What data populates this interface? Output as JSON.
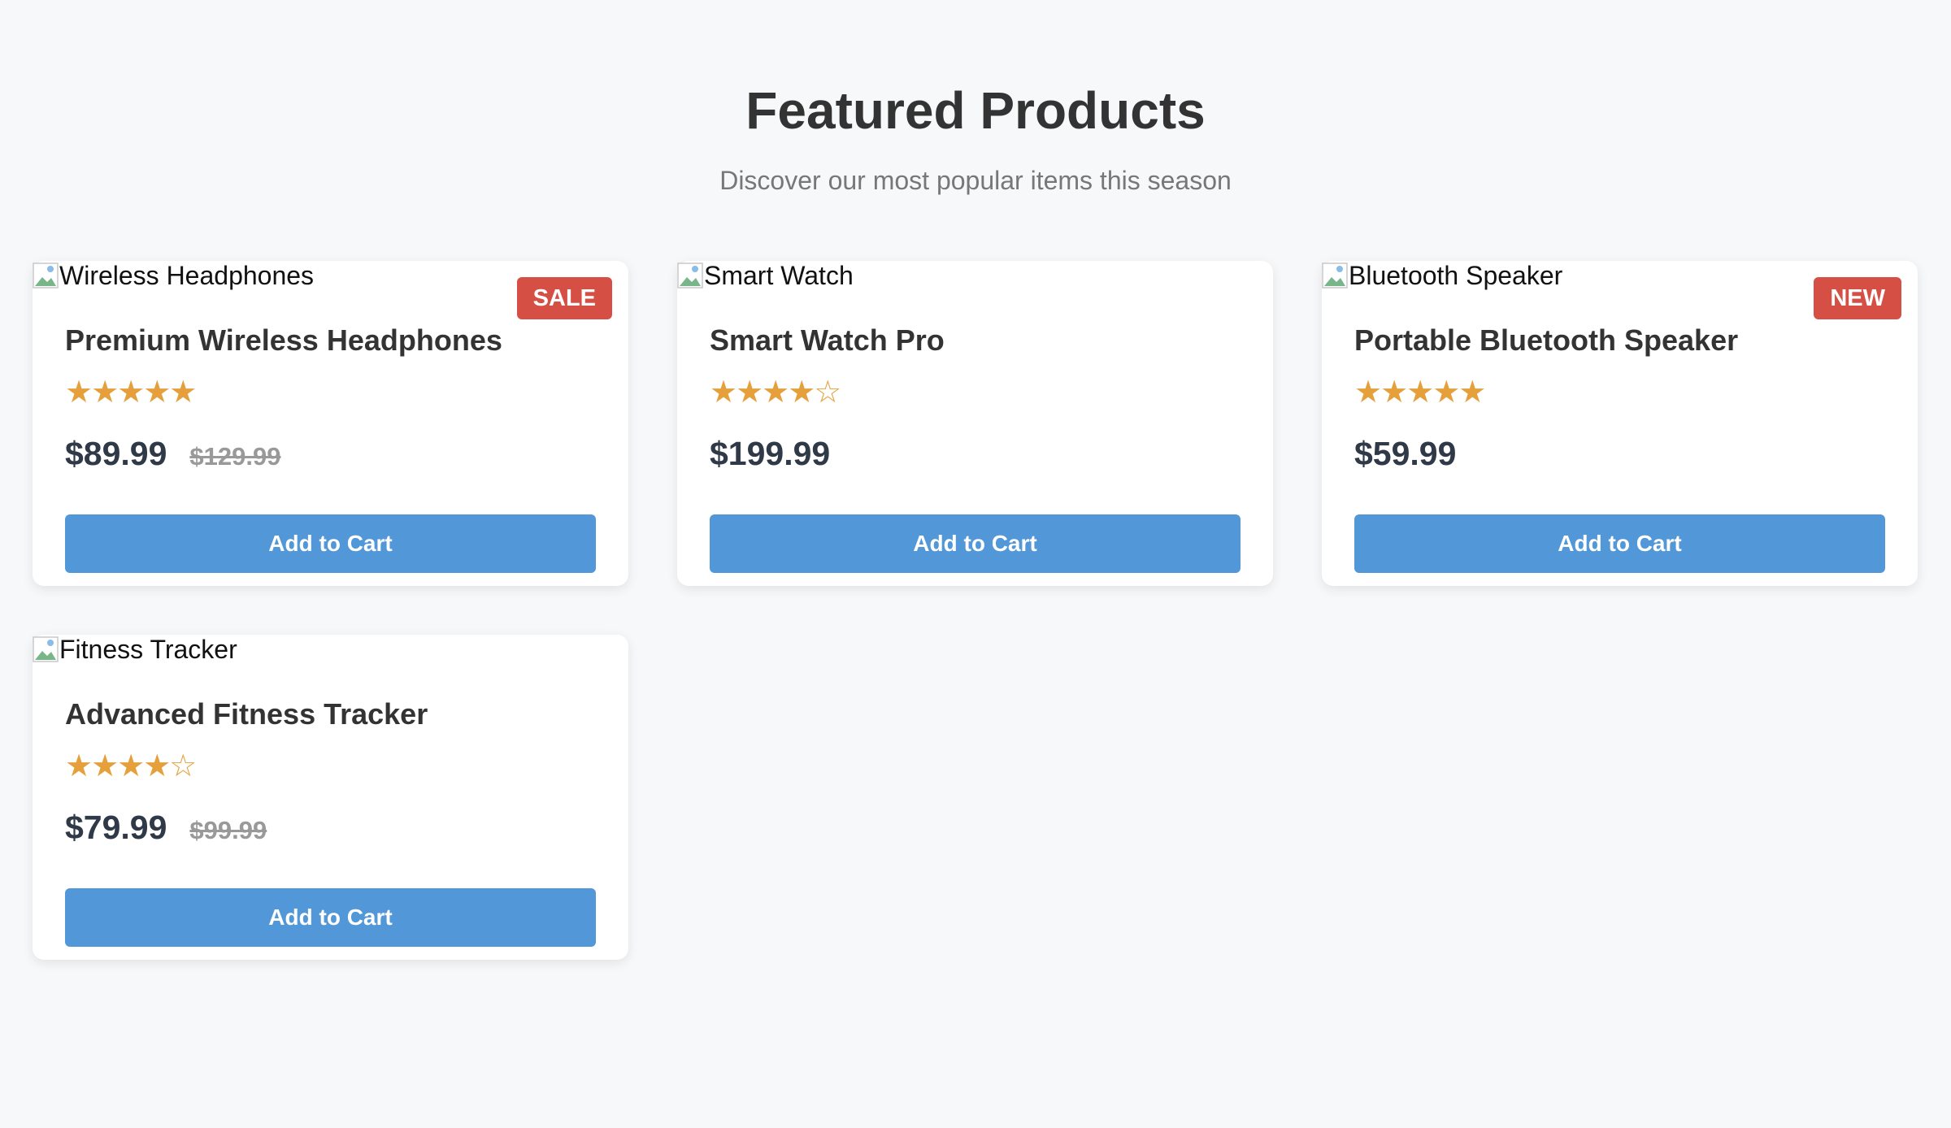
{
  "header": {
    "title": "Featured Products",
    "subtitle": "Discover our most popular items this season"
  },
  "products": [
    {
      "image_alt": "Wireless Headphones",
      "badge": "SALE",
      "name": "Premium Wireless Headphones",
      "rating": 5,
      "rating_display": "★★★★★",
      "price": "$89.99",
      "original_price": "$129.99",
      "button_label": "Add to Cart"
    },
    {
      "image_alt": "Smart Watch",
      "name": "Smart Watch Pro",
      "rating": 4,
      "rating_display": "★★★★☆",
      "price": "$199.99",
      "button_label": "Add to Cart"
    },
    {
      "image_alt": "Bluetooth Speaker",
      "badge": "NEW",
      "name": "Portable Bluetooth Speaker",
      "rating": 5,
      "rating_display": "★★★★★",
      "price": "$59.99",
      "button_label": "Add to Cart"
    },
    {
      "image_alt": "Fitness Tracker",
      "name": "Advanced Fitness Tracker",
      "rating": 4,
      "rating_display": "★★★★☆",
      "price": "$79.99",
      "original_price": "$99.99",
      "button_label": "Add to Cart"
    }
  ],
  "icons": {
    "product_image": "broken-image-icon",
    "rating": "star-icon"
  },
  "colors": {
    "background": "#f7f8fa",
    "card": "#ffffff",
    "accent": "#5297d7",
    "badge": "#d64f45",
    "star": "#e6a03b",
    "price": "#2f3947",
    "muted": "#999999"
  }
}
